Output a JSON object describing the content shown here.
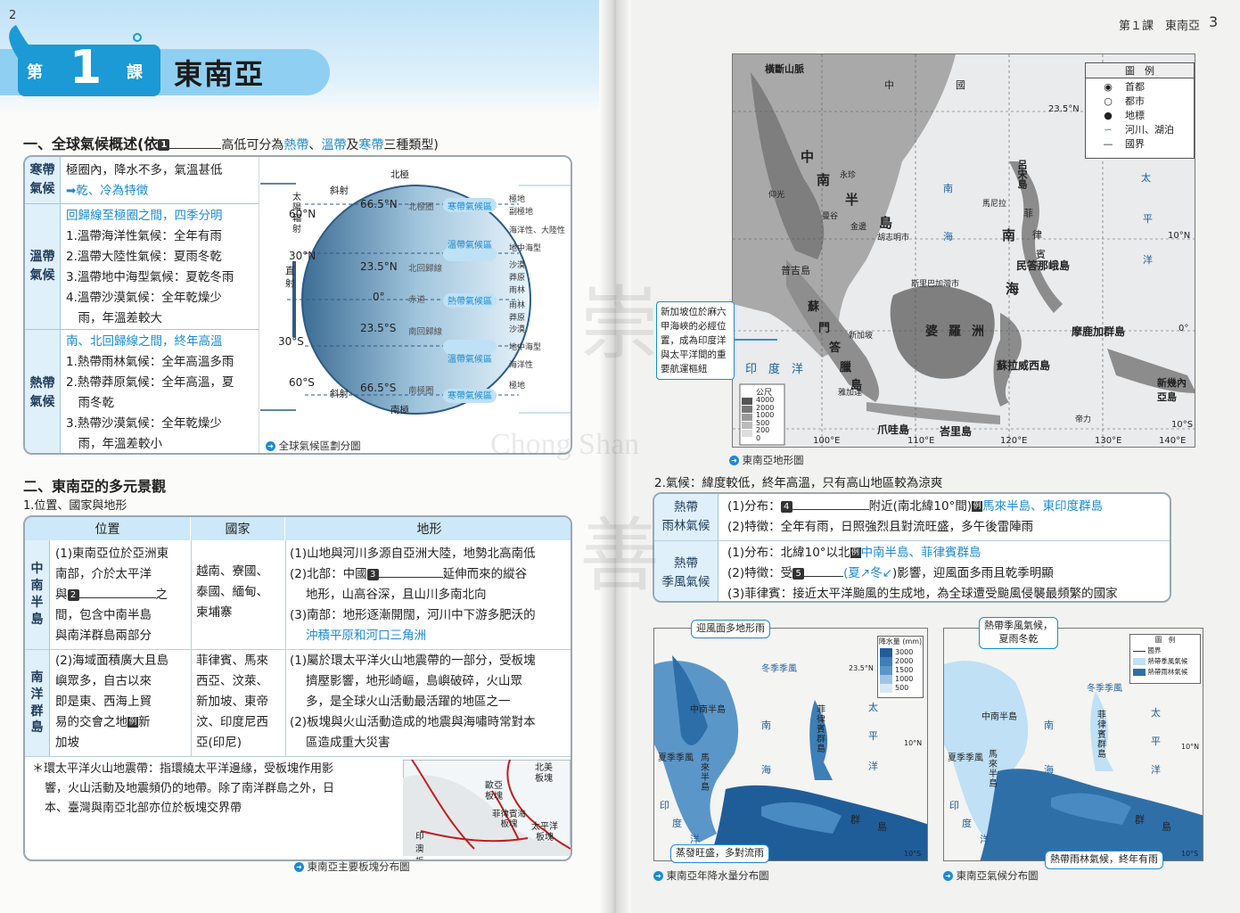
{
  "left": {
    "page_number": "2",
    "lesson_prefix": "第",
    "lesson_number": "1",
    "lesson_suffix": "課",
    "lesson_title": "東南亞",
    "section1": {
      "heading_a": "一、全球氣候概述(依",
      "heading_num": "1",
      "heading_b": "高低可分為",
      "heading_c": "熱帶",
      "heading_d": "、",
      "heading_e": "溫帶",
      "heading_f": "及",
      "heading_g": "寒帶",
      "heading_h": "三種類型)",
      "rows": [
        {
          "label": "寒帶\n氣候",
          "lines": [
            "極圈內，降水不多，氣溫甚低",
            "➡乾、冷為特徵"
          ]
        },
        {
          "label": "溫帶\n氣候",
          "lines": [
            "回歸線至極圈之間，四季分明",
            "1.溫帶海洋性氣候：全年有雨",
            "2.溫帶大陸性氣候：夏雨冬乾",
            "3.溫帶地中海型氣候：夏乾冬雨",
            "4.溫帶沙漠氣候：全年乾燥少",
            "　雨，年溫差較大"
          ]
        },
        {
          "label": "熱帶\n氣候",
          "lines": [
            "南、北回歸線之間，終年高溫",
            "1.熱帶雨林氣候：全年高溫多雨",
            "2.熱帶莽原氣候：全年高溫，夏",
            "　雨冬乾",
            "3.熱帶沙漠氣候：全年乾燥少",
            "　雨，年溫差較小"
          ]
        }
      ],
      "diagram": {
        "lat_labels": [
          "60°N",
          "30°N",
          "0°",
          "30°S",
          "60°S"
        ],
        "circle_labels": [
          "66.5°N",
          "23.5°N",
          "0°",
          "23.5°S",
          "66.5°S"
        ],
        "line_names": [
          "北極圈",
          "北回歸線",
          "赤道",
          "南回歸線",
          "南極圈"
        ],
        "zones": [
          "寒帶氣候區",
          "溫帶氣候區",
          "熱帶氣候區",
          "溫帶氣候區",
          "寒帶氣候區"
        ],
        "types": [
          "極地",
          "副極地",
          "海洋性、大陸性",
          "地中海型",
          "沙漠",
          "莽原",
          "雨林",
          "莽原",
          "沙漠",
          "地中海型",
          "海洋性",
          "極地"
        ],
        "north_pole": "北極",
        "south_pole": "南極",
        "oblique": "斜射",
        "direct": "直\n射",
        "sun": "太\n陽\n輻\n射",
        "caption": "全球氣候區劃分圖"
      }
    },
    "section2": {
      "heading": "二、東南亞的多元景觀",
      "subheading": "1.位置、國家與地形",
      "col_heads": [
        "位置",
        "國家",
        "地形"
      ],
      "row1_label": "中\n南\n半\n島",
      "row2_label": "南\n洋\n群\n島",
      "row1_pos": [
        "(1)東南亞位於亞洲東",
        "南部，介於太平洋",
        "與",
        "之",
        "間，包含中南半島",
        "與南洋群島兩部分"
      ],
      "row1_pos_num": "2",
      "row1_countries": [
        "越南、寮國、",
        "泰國、緬甸、",
        "柬埔寨"
      ],
      "row1_terrain": [
        "(1)山地與河川多源自亞洲大陸，地勢北高南低",
        "(2)北部：中國",
        "延伸而來的縱谷",
        "地形，山高谷深，且山川多南北向",
        "(3)南部：地形逐漸開闊，河川中下游多肥沃的",
        "沖積平原和河口三角洲"
      ],
      "row1_terrain_num": "3",
      "row2_pos": [
        "(2)海域面積廣大且島",
        "嶼眾多，自古以來",
        "即是東、西海上貿",
        "易的交會之地",
        "新",
        "加坡"
      ],
      "row2_countries": [
        "菲律賓、馬來",
        "西亞、汶萊、",
        "新加坡、東帝",
        "汶、印度尼西",
        "亞(印尼)"
      ],
      "row2_terrain": [
        "(1)屬於環太平洋火山地震帶的一部分，受板塊",
        "擠壓影響，地形崎嶇，島嶼破碎，火山眾",
        "多，是全球火山活動最活躍的地區之一",
        "(2)板塊與火山活動造成的地震與海嘯時常對本",
        "區造成重大災害"
      ],
      "note": [
        "＊環太平洋火山地震帶：指環繞太平洋邊緣，受板塊作用影",
        "響，火山活動及地震頻仍的地帶。除了南洋群島之外，日",
        "本、臺灣與南亞北部亦位於板塊交界帶"
      ],
      "plate_map": {
        "labels": [
          "歐亞\n板塊",
          "北美\n板塊",
          "菲律賓海\n板塊",
          "太平洋\n板塊",
          "印\n澳\n板\n塊"
        ],
        "caption": "東南亞主要板塊分布圖"
      },
      "example_mark": "例"
    }
  },
  "right": {
    "page_header": "第１課　東南亞",
    "page_number": "3",
    "map1": {
      "legend_title": "圖　例",
      "legend_items": [
        "首都",
        "都市",
        "地標",
        "河川、湖泊",
        "國界"
      ],
      "places": [
        "橫斷山脈",
        "中",
        "國",
        "中",
        "南",
        "半",
        "島",
        "南",
        "海",
        "菲",
        "律",
        "賓",
        "呂宋島",
        "南",
        "海",
        "太",
        "平",
        "洋",
        "印",
        "度",
        "洋",
        "蘇",
        "門",
        "答",
        "臘",
        "島",
        "婆",
        "羅",
        "洲",
        "爪哇島",
        "峇里島",
        "蘇拉威西島",
        "摩鹿加群島",
        "民答那峨島",
        "新幾內亞島",
        "普吉島",
        "馬尼拉",
        "曼谷",
        "金邊",
        "永珍",
        "仰光",
        "胡志明市",
        "新加坡",
        "雅加達",
        "斯里巴加灣市",
        "帝力"
      ],
      "lats": [
        "23.5°N",
        "10°N",
        "0°",
        "10°S"
      ],
      "lons": [
        "100°E",
        "110°E",
        "120°E",
        "130°E",
        "140°E"
      ],
      "elev_title": "公尺",
      "elev_values": [
        "4000",
        "2000",
        "1000",
        "500",
        "200",
        "0"
      ],
      "note": [
        "新加坡位於麻六",
        "甲海峽的必經位",
        "置，成為印度洋",
        "與太平洋間的重",
        "要航運樞紐"
      ],
      "caption": "東南亞地形圖"
    },
    "climate": {
      "heading": "2.氣候：緯度較低，終年高溫，只有高山地區較為涼爽",
      "rainforest_label": "熱帶\n雨林氣候",
      "rainforest_lines": [
        "(1)分布：",
        "附近(南北緯10°間)",
        "馬來半島、東印度群島",
        "(2)特徵：全年有雨，日照強烈且對流旺盛，多午後雷陣雨"
      ],
      "rainforest_num": "4",
      "monsoon_label": "熱帶\n季風氣候",
      "monsoon_lines": [
        "(1)分布：北緯10°以北",
        "中南半島、菲律賓群島",
        "(2)特徵：受",
        "(夏",
        "冬",
        ")影響，迎風面多雨且乾季明顯",
        "(3)菲律賓：接近太平洋颱風的生成地，為全球遭受颱風侵襲最頻繁的國家"
      ],
      "monsoon_num": "5",
      "example_mark": "例"
    },
    "map2": {
      "callout_top": "迎風面多地形雨",
      "callout_bottom": "蒸發旺盛，多對流雨",
      "legend_title": "降水量 (mm)",
      "legend_values": [
        "3000",
        "2000",
        "1500",
        "1000",
        "500"
      ],
      "labels": [
        "中南半島",
        "菲律賓群島",
        "馬來半島",
        "冬季季風",
        "夏季季風",
        "南",
        "海",
        "太",
        "平",
        "洋",
        "印",
        "度",
        "洋",
        "群",
        "島",
        "23.5°N",
        "10°N",
        "10°S"
      ],
      "caption": "東南亞年降水量分布圖"
    },
    "map3": {
      "callout_top": "熱帶季風氣候，\n夏雨冬乾",
      "callout_bottom": "熱帶雨林氣候，終年有雨",
      "legend_title": "圖　例",
      "legend_items": [
        "國界",
        "熱帶季風氣候",
        "熱帶雨林氣候"
      ],
      "labels": [
        "中南半島",
        "菲律賓群島",
        "馬來半島",
        "冬季季風",
        "夏季季風",
        "南",
        "海",
        "太",
        "平",
        "洋",
        "印",
        "度",
        "洋",
        "群",
        "島",
        "10°N",
        "10°S"
      ],
      "caption": "東南亞氣候分布圖"
    },
    "watermark": [
      "崇",
      "善",
      "Chong Shan"
    ]
  },
  "colors": {
    "accent": "#1b9ad6",
    "blue_text": "#1c8bd1",
    "light_blue": "#dff0fb",
    "header_blue": "#8fd0f2"
  }
}
